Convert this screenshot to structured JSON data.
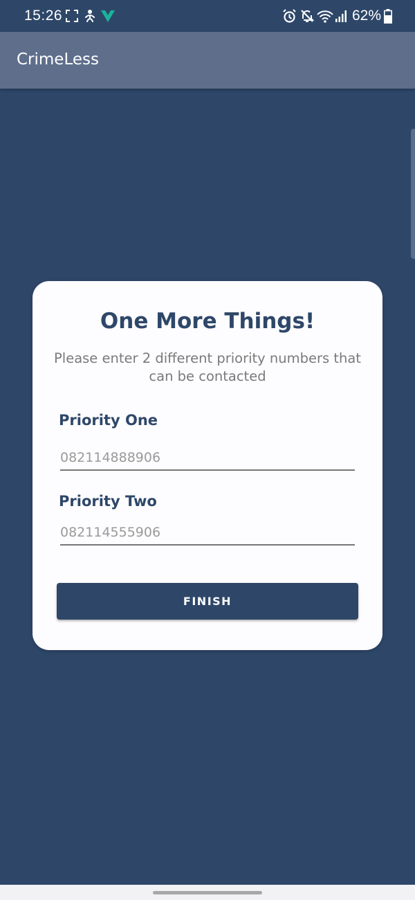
{
  "status_bar": {
    "time": "15:26",
    "battery": "62%",
    "icons": [
      "screenshot-icon",
      "accessibility-icon",
      "vpn-shield-icon",
      "alarm-icon",
      "mute-icon",
      "wifi-icon",
      "signal-icon",
      "battery-icon"
    ]
  },
  "app_bar": {
    "title": "CrimeLess"
  },
  "card": {
    "title": "One More Things!",
    "subtitle": "Please enter 2 different priority numbers that can be contacted",
    "fields": [
      {
        "label": "Priority One",
        "placeholder": "082114888906",
        "value": ""
      },
      {
        "label": "Priority Two",
        "placeholder": "082114555906",
        "value": ""
      }
    ],
    "finish_label": "FINISH"
  },
  "colors": {
    "background": "#2e4769",
    "app_bar": "#5e6e8b",
    "accent": "#2e4769",
    "card": "#fdfcfe"
  }
}
